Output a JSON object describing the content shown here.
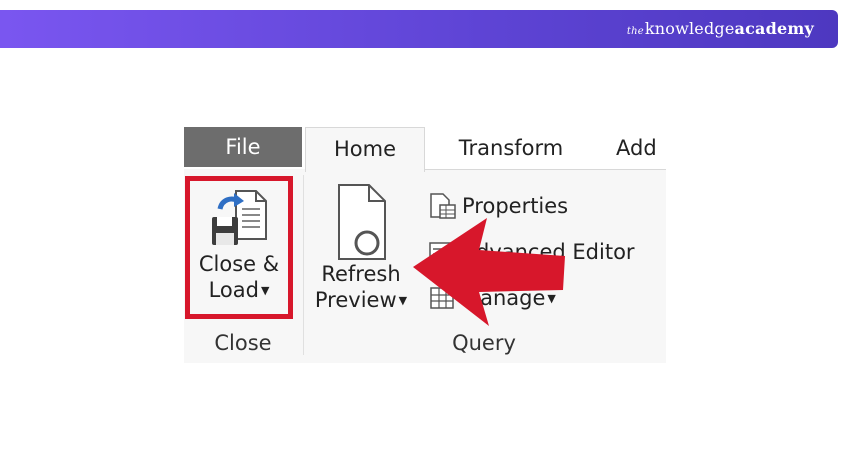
{
  "brand": {
    "the": "the",
    "knowledge": "knowledge",
    "academy": "academy"
  },
  "ribbon": {
    "tabs": [
      {
        "label": "File"
      },
      {
        "label": "Home"
      },
      {
        "label": "Transform"
      },
      {
        "label": "Add"
      }
    ],
    "close_load": {
      "line1": "Close &",
      "line2": "Load"
    },
    "refresh_preview": {
      "line1": "Refresh",
      "line2": "Preview"
    },
    "commands": {
      "properties": "Properties",
      "advanced_editor": "Advanced Editor",
      "manage": "Manage"
    },
    "groups": {
      "close": "Close",
      "query": "Query"
    }
  },
  "colors": {
    "banner_start": "#7a56f0",
    "banner_end": "#4d38c0",
    "highlight": "#d7172b",
    "file_tab": "#6d6d6d"
  }
}
